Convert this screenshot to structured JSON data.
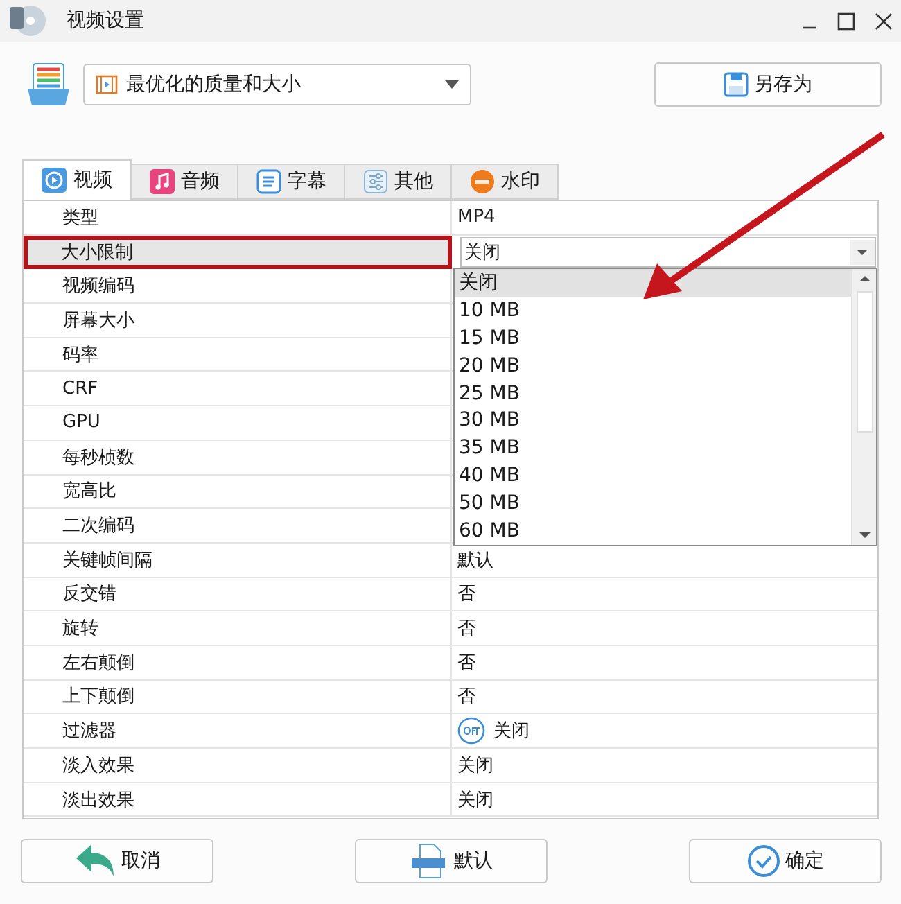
{
  "window": {
    "title": "视频设置"
  },
  "preset": {
    "value": "最优化的质量和大小"
  },
  "save_as_button": "另存为",
  "tabs": [
    {
      "label": "视频",
      "kind": "play",
      "selected": true
    },
    {
      "label": "音频",
      "kind": "music",
      "selected": false
    },
    {
      "label": "字幕",
      "kind": "list",
      "selected": false
    },
    {
      "label": "其他",
      "kind": "sliders",
      "selected": false
    },
    {
      "label": "水印",
      "kind": "new",
      "selected": false
    }
  ],
  "rows": [
    {
      "label": "类型",
      "kind": "text",
      "value": "MP4",
      "selected": false,
      "highlighted": false
    },
    {
      "label": "大小限制",
      "kind": "combo",
      "value": "关闭",
      "selected": true,
      "highlighted": true
    },
    {
      "label": "视频编码",
      "kind": "hidden",
      "selected": false,
      "highlighted": false
    },
    {
      "label": "屏幕大小",
      "kind": "hidden",
      "selected": false,
      "highlighted": false
    },
    {
      "label": "码率",
      "kind": "hidden",
      "selected": false,
      "highlighted": false
    },
    {
      "label": "CRF",
      "kind": "hidden",
      "selected": false,
      "highlighted": false
    },
    {
      "label": "GPU",
      "kind": "hidden",
      "selected": false,
      "highlighted": false
    },
    {
      "label": "每秒桢数",
      "kind": "hidden",
      "selected": false,
      "highlighted": false
    },
    {
      "label": "宽高比",
      "kind": "hidden",
      "selected": false,
      "highlighted": false
    },
    {
      "label": "二次编码",
      "kind": "hidden",
      "selected": false,
      "highlighted": false
    },
    {
      "label": "关键帧间隔",
      "kind": "text",
      "value": "默认",
      "selected": false,
      "highlighted": false
    },
    {
      "label": "反交错",
      "kind": "text",
      "value": "否",
      "selected": false,
      "highlighted": false
    },
    {
      "label": "旋转",
      "kind": "text",
      "value": "否",
      "selected": false,
      "highlighted": false
    },
    {
      "label": "左右颠倒",
      "kind": "text",
      "value": "否",
      "selected": false,
      "highlighted": false
    },
    {
      "label": "上下颠倒",
      "kind": "text",
      "value": "否",
      "selected": false,
      "highlighted": false
    },
    {
      "label": "过滤器",
      "kind": "toggle",
      "value": "关闭",
      "selected": false,
      "highlighted": false
    },
    {
      "label": "淡入效果",
      "kind": "text",
      "value": "关闭",
      "selected": false,
      "highlighted": false
    },
    {
      "label": "淡出效果",
      "kind": "text",
      "value": "关闭",
      "selected": false,
      "highlighted": false
    }
  ],
  "dropdown": {
    "options": [
      {
        "label": "关闭",
        "selected": true
      },
      {
        "label": "10 MB",
        "selected": false
      },
      {
        "label": "15 MB",
        "selected": false
      },
      {
        "label": "20 MB",
        "selected": false
      },
      {
        "label": "25 MB",
        "selected": false
      },
      {
        "label": "30 MB",
        "selected": false
      },
      {
        "label": "35 MB",
        "selected": false
      },
      {
        "label": "40 MB",
        "selected": false
      },
      {
        "label": "50 MB",
        "selected": false
      },
      {
        "label": "60 MB",
        "selected": false
      }
    ]
  },
  "buttons": [
    {
      "label": "取消",
      "kind": "cancel"
    },
    {
      "label": "默认",
      "kind": "default"
    },
    {
      "label": "确定",
      "kind": "ok"
    }
  ]
}
